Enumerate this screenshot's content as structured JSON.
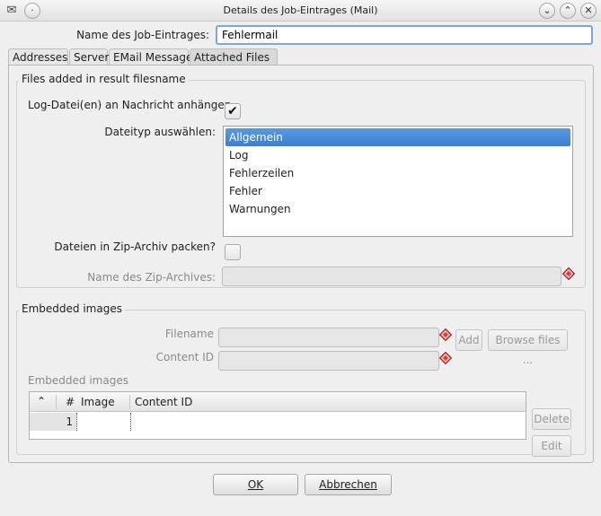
{
  "window": {
    "title": "Details des Job-Eintrages (Mail)",
    "app_icon": "envelope-icon",
    "controls": [
      "minimize-icon",
      "maximize-icon",
      "close-icon"
    ]
  },
  "job_name": {
    "label": "Name des Job-Eintrages:",
    "value": "Fehlermail"
  },
  "tabs": [
    {
      "label": "Addresses",
      "active": false
    },
    {
      "label": "Server",
      "active": false
    },
    {
      "label": "EMail Message",
      "active": false
    },
    {
      "label": "Attached Files",
      "active": true
    }
  ],
  "files_group": {
    "title": "Files added in result filesname",
    "log_attach_label": "Log-Datei(en) an Nachricht anhängen",
    "log_attach_checked": true,
    "filetype_label": "Dateityp auswählen:",
    "filetypes": [
      "Allgemein",
      "Log",
      "Fehlerzeilen",
      "Fehler",
      "Warnungen"
    ],
    "selected_filetype": "Allgemein",
    "zip_label": "Dateien in Zip-Archiv packen?",
    "zip_checked": false,
    "zip_name_label": "Name des Zip-Archives:",
    "zip_name_value": ""
  },
  "images_group": {
    "title": "Embedded images",
    "filename_label": "Filename",
    "filename_value": "",
    "content_id_label": "Content ID",
    "content_id_value": "",
    "add_label": "Add",
    "browse_label": "Browse files ...",
    "table_title": "Embedded images",
    "table": {
      "columns": [
        "#",
        "Image",
        "Content ID"
      ],
      "sort_icon": "chevron-up-icon",
      "rows": [
        {
          "num": "1",
          "image": "",
          "content_id": ""
        }
      ]
    },
    "delete_label": "Delete",
    "edit_label": "Edit"
  },
  "footer": {
    "ok_label": "OK",
    "cancel_label": "Abbrechen"
  },
  "colors": {
    "selection": "#3a7fd3",
    "focus_border": "#7aa7de",
    "error_marker": "#d43a3a"
  }
}
